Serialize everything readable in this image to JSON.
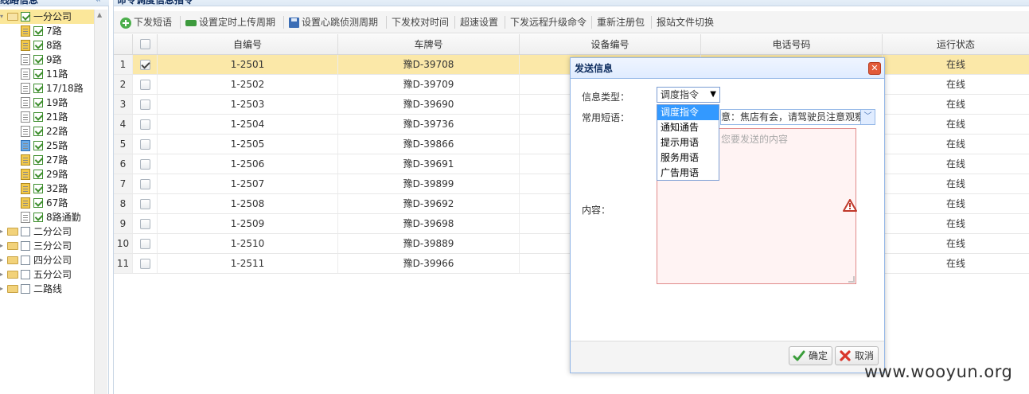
{
  "left_panel": {
    "title": "线路信息",
    "collapse_glyph": "«",
    "tree": [
      {
        "label": "一分公司",
        "checked": true,
        "expanded": true,
        "selected": true,
        "type": "folder",
        "depth": 0
      },
      {
        "label": "7路",
        "checked": true,
        "type": "device",
        "style": "gold",
        "depth": 1
      },
      {
        "label": "8路",
        "checked": true,
        "type": "device",
        "style": "gold",
        "depth": 1
      },
      {
        "label": "9路",
        "checked": true,
        "type": "device",
        "style": "plain",
        "depth": 1
      },
      {
        "label": "11路",
        "checked": true,
        "type": "device",
        "style": "plain",
        "depth": 1
      },
      {
        "label": "17/18路",
        "checked": true,
        "type": "device",
        "style": "plain",
        "depth": 1
      },
      {
        "label": "19路",
        "checked": true,
        "type": "device",
        "style": "plain",
        "depth": 1
      },
      {
        "label": "21路",
        "checked": true,
        "type": "device",
        "style": "plain",
        "depth": 1
      },
      {
        "label": "22路",
        "checked": true,
        "type": "device",
        "style": "plain",
        "depth": 1
      },
      {
        "label": "25路",
        "checked": true,
        "type": "device",
        "style": "blue",
        "depth": 1
      },
      {
        "label": "27路",
        "checked": true,
        "type": "device",
        "style": "gold",
        "depth": 1
      },
      {
        "label": "29路",
        "checked": true,
        "type": "device",
        "style": "gold",
        "depth": 1
      },
      {
        "label": "32路",
        "checked": true,
        "type": "device",
        "style": "gold",
        "depth": 1
      },
      {
        "label": "67路",
        "checked": true,
        "type": "device",
        "style": "gold",
        "depth": 1
      },
      {
        "label": "8路通勤",
        "checked": true,
        "type": "device",
        "style": "plain",
        "depth": 1
      },
      {
        "label": "二分公司",
        "checked": false,
        "type": "folder",
        "depth": 0
      },
      {
        "label": "三分公司",
        "checked": false,
        "type": "folder",
        "depth": 0
      },
      {
        "label": "四分公司",
        "checked": false,
        "type": "folder",
        "depth": 0
      },
      {
        "label": "五分公司",
        "checked": false,
        "type": "folder",
        "depth": 0
      },
      {
        "label": "二路线",
        "checked": false,
        "type": "folder",
        "depth": 0
      }
    ]
  },
  "main_panel": {
    "title": "命令调度信息指令",
    "toolbar": [
      {
        "label": "下发短语",
        "icon": "add-icon"
      },
      {
        "label": "设置定时上传周期",
        "icon": "bar-icon"
      },
      {
        "label": "设置心跳侦测周期",
        "icon": "save-icon"
      },
      {
        "label": "下发校对时间",
        "icon": ""
      },
      {
        "label": "超速设置",
        "icon": ""
      },
      {
        "label": "下发远程升级命令",
        "icon": ""
      },
      {
        "label": "重新注册包",
        "icon": ""
      },
      {
        "label": "报站文件切换",
        "icon": ""
      }
    ],
    "columns": [
      "自编号",
      "车牌号",
      "设备编号",
      "电话号码",
      "运行状态"
    ],
    "rows": [
      {
        "n": "1",
        "id": "1-2501",
        "plate": "豫D-39708",
        "status": "在线",
        "checked": true,
        "selected": true
      },
      {
        "n": "2",
        "id": "1-2502",
        "plate": "豫D-39709",
        "status": "在线"
      },
      {
        "n": "3",
        "id": "1-2503",
        "plate": "豫D-39690",
        "status": "在线"
      },
      {
        "n": "4",
        "id": "1-2504",
        "plate": "豫D-39736",
        "status": "在线"
      },
      {
        "n": "5",
        "id": "1-2505",
        "plate": "豫D-39866",
        "status": "在线"
      },
      {
        "n": "6",
        "id": "1-2506",
        "plate": "豫D-39691",
        "status": "在线"
      },
      {
        "n": "7",
        "id": "1-2507",
        "plate": "豫D-39899",
        "status": "在线"
      },
      {
        "n": "8",
        "id": "1-2508",
        "plate": "豫D-39692",
        "status": "在线"
      },
      {
        "n": "9",
        "id": "1-2509",
        "plate": "豫D-39698",
        "status": "在线"
      },
      {
        "n": "10",
        "id": "1-2510",
        "plate": "豫D-39889",
        "status": "在线"
      },
      {
        "n": "11",
        "id": "1-2511",
        "plate": "豫D-39966",
        "status": "在线"
      }
    ]
  },
  "dialog": {
    "title": "发送信息",
    "close_glyph": "✕",
    "type_label": "信息类型：",
    "type_value": "调度指令",
    "type_options": [
      "调度指令",
      "通知通告",
      "提示用语",
      "服务用语",
      "广告用语"
    ],
    "phrase_label": "常用短语：",
    "phrase_value": "意：焦店有会，请驾驶员注意观察",
    "content_label": "内容：",
    "content_placeholder": "您要发送的内容",
    "ok_label": "确定",
    "cancel_label": "取消"
  },
  "watermark": "www.wooyun.org"
}
